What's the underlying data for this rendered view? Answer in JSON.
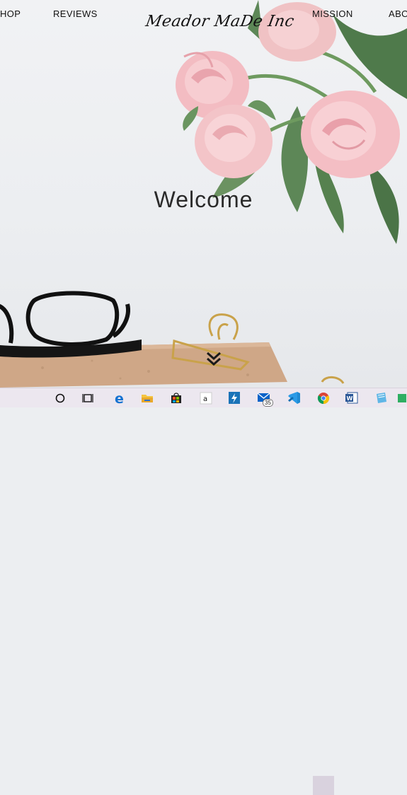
{
  "nav": {
    "shop": "HOP",
    "reviews": "REVIEWS",
    "logo": "Meador MaDe Inc",
    "mission": "MISSION",
    "about": "ABO"
  },
  "hero": {
    "title": "Welcome",
    "scroll_icon": "double-chevron-down-icon"
  },
  "taskbar": {
    "items": [
      {
        "name": "cortana-search",
        "icon": "circle-icon"
      },
      {
        "name": "task-view",
        "icon": "task-view-icon"
      },
      {
        "name": "edge",
        "icon": "edge-icon"
      },
      {
        "name": "file-explorer",
        "icon": "folder-icon"
      },
      {
        "name": "store",
        "icon": "store-icon"
      },
      {
        "name": "amazon",
        "icon": "amazon-icon",
        "label": "a"
      },
      {
        "name": "bolt-app",
        "icon": "bolt-icon"
      },
      {
        "name": "mail",
        "icon": "mail-icon",
        "badge": "35"
      },
      {
        "name": "vscode",
        "icon": "vscode-icon"
      },
      {
        "name": "chrome",
        "icon": "chrome-icon"
      },
      {
        "name": "word",
        "icon": "word-icon",
        "label": "W"
      },
      {
        "name": "notepad",
        "icon": "notepad-icon"
      },
      {
        "name": "app-extra",
        "icon": "app-icon"
      }
    ]
  },
  "colors": {
    "background": "#eceef1",
    "taskbar": "#ece7ef",
    "rose": "#f1b6bd",
    "leaf": "#4f7a4b",
    "cork": "#cfa787"
  }
}
